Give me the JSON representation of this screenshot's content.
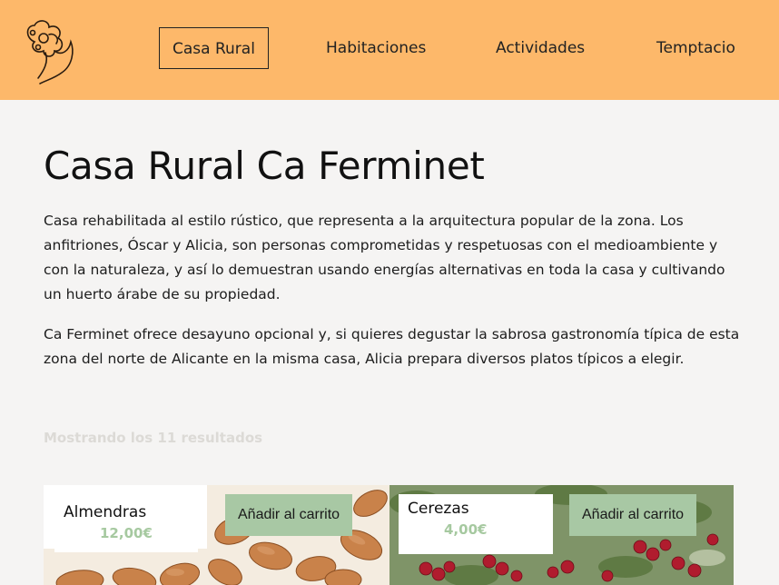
{
  "header": {
    "nav": [
      {
        "label": "Casa Rural",
        "active": true
      },
      {
        "label": "Habitaciones",
        "active": false
      },
      {
        "label": "Actividades",
        "active": false
      },
      {
        "label": "Temptacio",
        "active": false
      }
    ],
    "logo_icon": "flower-logo-icon",
    "background_color": "#fdb86a"
  },
  "main": {
    "title": "Casa Rural Ca Ferminet",
    "paragraphs": [
      "Casa rehabilitada al estilo rústico, que representa a la arquitectura popular de la zona. Los anfitriones, Óscar y Alicia, son personas comprometidas y respetuosas con el medioambiente y con la naturaleza, y así lo demuestran usando energías alternativas en toda la casa y cultivando un huerto árabe de su propiedad.",
      "Ca Ferminet ofrece desayuno opcional y, si quieres degustar la sabrosa gastronomía típica de esta zona del norte de Alicante en la misma casa, Alicia prepara diversos platos típicos a elegir."
    ],
    "results_text": "Mostrando los 11 resultados"
  },
  "products": [
    {
      "name": "Almendras",
      "price": "12,00€",
      "button": "Añadir al carrito"
    },
    {
      "name": "Cerezas",
      "price": "4,00€",
      "button": "Añadir al carrito"
    }
  ],
  "colors": {
    "accent": "#fdb86a",
    "button": "#a8c8a4",
    "price": "#a6c9a0",
    "background": "#f5f4f3"
  }
}
